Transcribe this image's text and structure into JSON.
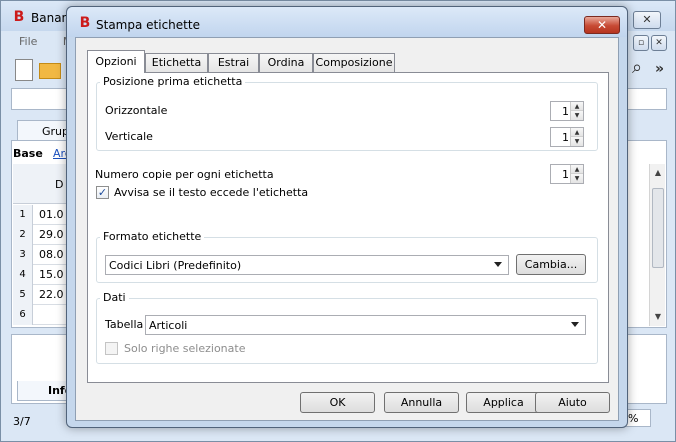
{
  "background_app": {
    "title": "Banana",
    "menu": [
      "File",
      "M"
    ],
    "tab_label": "Grupp",
    "section_label": "Base",
    "link_text": "Arc",
    "grid_header": "D",
    "rows": [
      {
        "num": "1",
        "value": "01.0"
      },
      {
        "num": "2",
        "value": "29.0"
      },
      {
        "num": "3",
        "value": "08.0"
      },
      {
        "num": "4",
        "value": "15.0"
      },
      {
        "num": "5",
        "value": "22.0"
      },
      {
        "num": "6",
        "value": ""
      }
    ],
    "info_tab": "Info",
    "status_left": "3/7",
    "status_right": "%"
  },
  "dialog": {
    "title": "Stampa etichette",
    "close_symbol": "✕",
    "tabs": [
      {
        "label": "Opzioni",
        "active": true
      },
      {
        "label": "Etichetta",
        "active": false
      },
      {
        "label": "Estrai",
        "active": false
      },
      {
        "label": "Ordina",
        "active": false
      },
      {
        "label": "Composizione",
        "active": false
      }
    ],
    "position_group": {
      "title": "Posizione prima etichetta",
      "horizontal_label": "Orizzontale",
      "horizontal_value": "1",
      "vertical_label": "Verticale",
      "vertical_value": "1"
    },
    "copies_label": "Numero copie per ogni etichetta",
    "copies_value": "1",
    "warn_checkbox": {
      "label": "Avvisa se il testo eccede l'etichetta",
      "checked": true
    },
    "format_group": {
      "title": "Formato etichette",
      "selected": "Codici Libri (Predefinito)",
      "change_button": "Cambia..."
    },
    "data_group": {
      "title": "Dati",
      "table_label": "Tabella",
      "table_selected": "Articoli",
      "selected_rows_checkbox": {
        "label": "Solo righe selezionate",
        "checked": false,
        "enabled": false
      }
    },
    "buttons": {
      "ok": "OK",
      "cancel": "Annulla",
      "apply": "Applica",
      "help": "Aiuto"
    }
  }
}
